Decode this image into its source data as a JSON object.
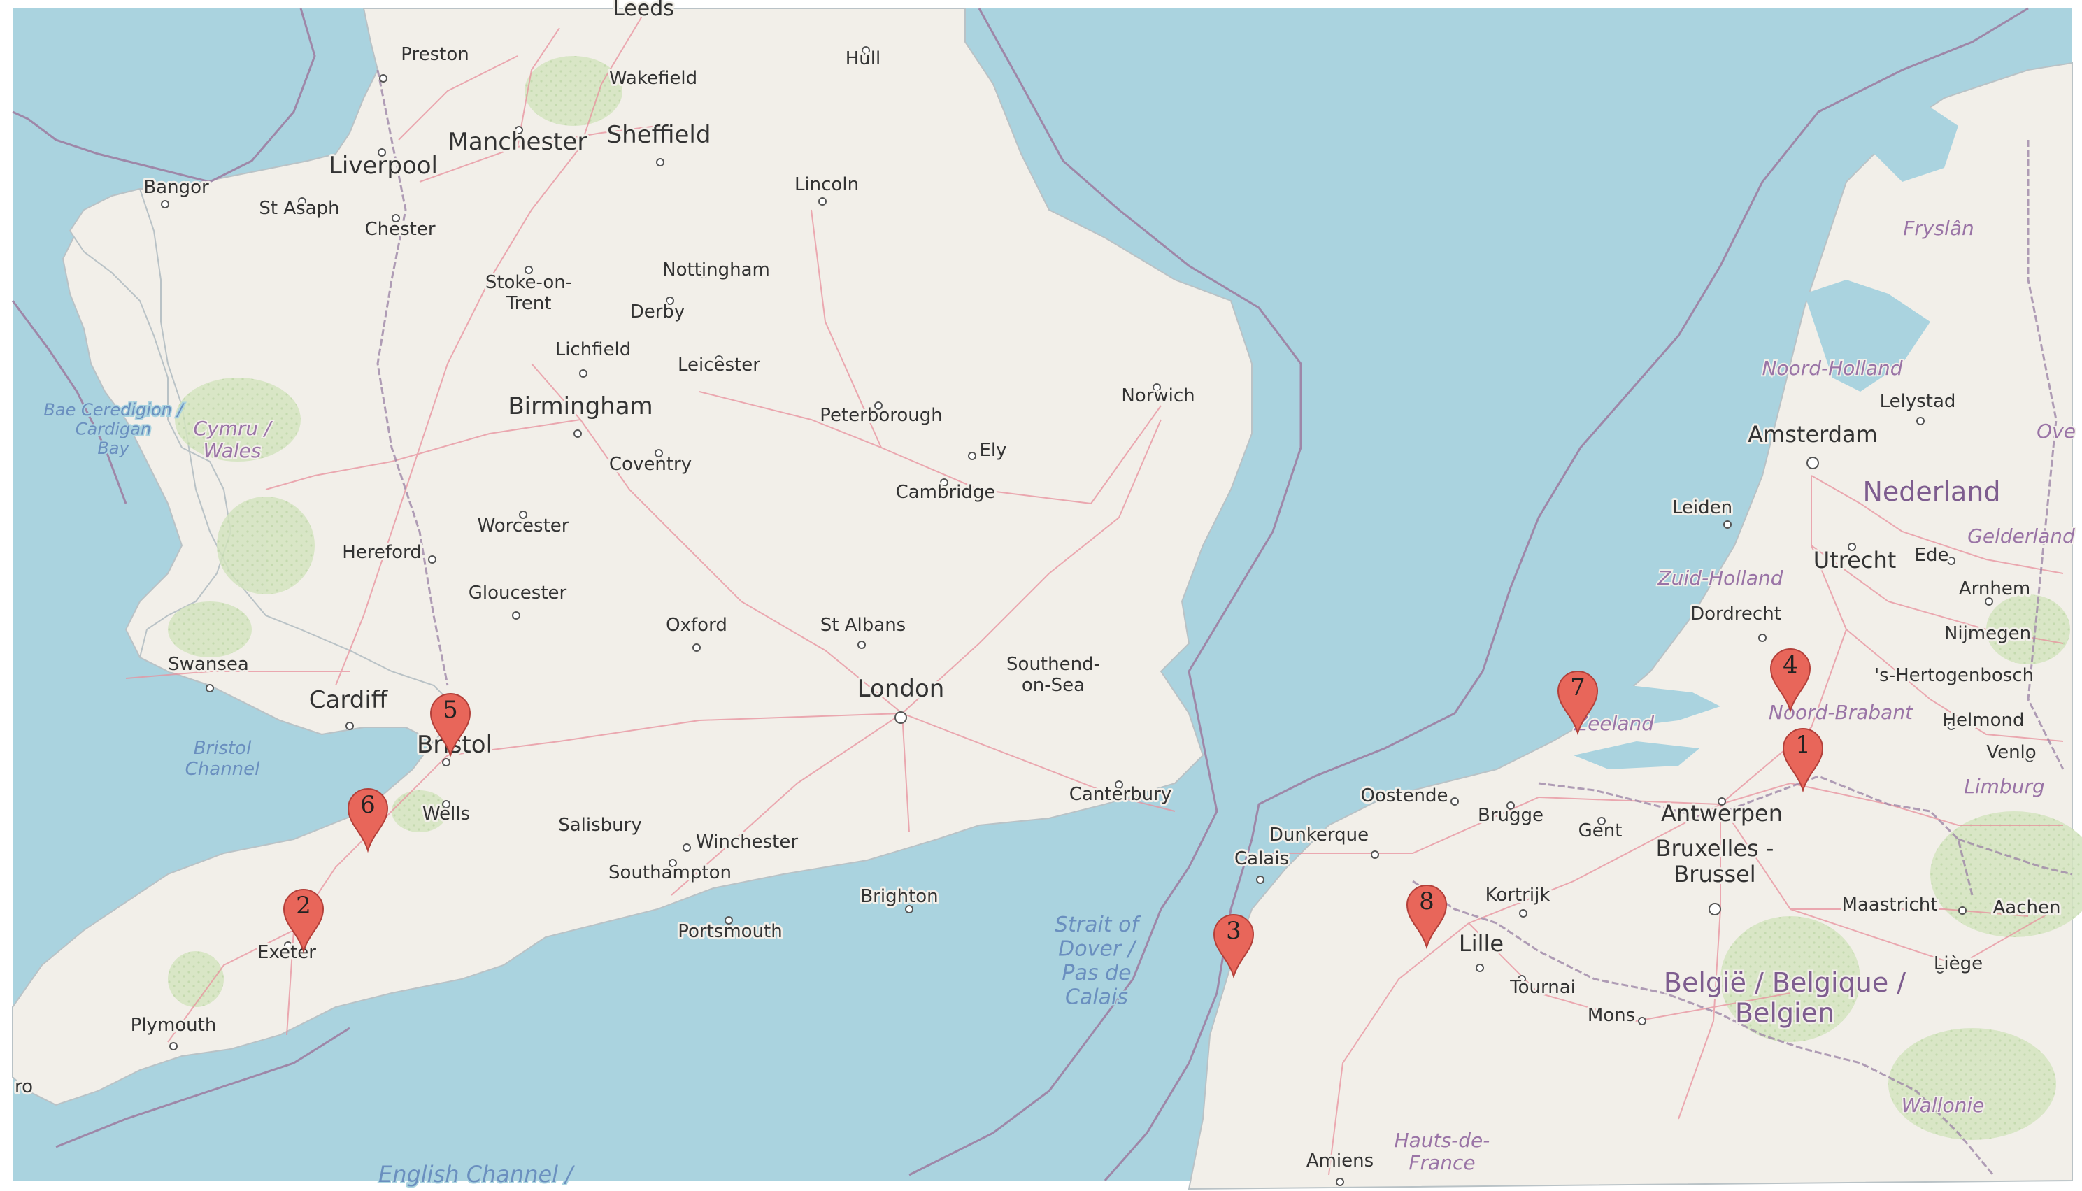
{
  "map": {
    "colors": {
      "water": "#aad3df",
      "land": "#f2efe9",
      "road": "#e8909c",
      "border": "#9e87a8",
      "marker": "#e8665a"
    },
    "cities": [
      {
        "id": "leeds",
        "name": "Leeds"
      },
      {
        "id": "preston",
        "name": "Preston"
      },
      {
        "id": "hull",
        "name": "Hull"
      },
      {
        "id": "wakefield",
        "name": "Wakefield"
      },
      {
        "id": "manchester",
        "name": "Manchester"
      },
      {
        "id": "sheffield",
        "name": "Sheffield"
      },
      {
        "id": "liverpool",
        "name": "Liverpool"
      },
      {
        "id": "bangor",
        "name": "Bangor"
      },
      {
        "id": "st-asaph",
        "name": "St Asaph"
      },
      {
        "id": "lincoln",
        "name": "Lincoln"
      },
      {
        "id": "chester",
        "name": "Chester"
      },
      {
        "id": "nottingham",
        "name": "Nottingham"
      },
      {
        "id": "stoke",
        "name": "Stoke-on-\nTrent"
      },
      {
        "id": "derby",
        "name": "Derby"
      },
      {
        "id": "lichfield",
        "name": "Lichfield"
      },
      {
        "id": "leicester",
        "name": "Leicester"
      },
      {
        "id": "norwich",
        "name": "Norwich"
      },
      {
        "id": "birmingham",
        "name": "Birmingham"
      },
      {
        "id": "peterborough",
        "name": "Peterborough"
      },
      {
        "id": "ely",
        "name": "Ely"
      },
      {
        "id": "coventry",
        "name": "Coventry"
      },
      {
        "id": "cambridge",
        "name": "Cambridge"
      },
      {
        "id": "worcester",
        "name": "Worcester"
      },
      {
        "id": "hereford",
        "name": "Hereford"
      },
      {
        "id": "gloucester",
        "name": "Gloucester"
      },
      {
        "id": "oxford",
        "name": "Oxford"
      },
      {
        "id": "st-albans",
        "name": "St Albans"
      },
      {
        "id": "swansea",
        "name": "Swansea"
      },
      {
        "id": "southend",
        "name": "Southend-\non-Sea"
      },
      {
        "id": "london",
        "name": "London"
      },
      {
        "id": "cardiff",
        "name": "Cardiff"
      },
      {
        "id": "bristol",
        "name": "Bristol"
      },
      {
        "id": "canterbury",
        "name": "Canterbury"
      },
      {
        "id": "wells",
        "name": "Wells"
      },
      {
        "id": "salisbury",
        "name": "Salisbury"
      },
      {
        "id": "winchester",
        "name": "Winchester"
      },
      {
        "id": "southampton",
        "name": "Southampton"
      },
      {
        "id": "brighton",
        "name": "Brighton"
      },
      {
        "id": "portsmouth",
        "name": "Portsmouth"
      },
      {
        "id": "exeter",
        "name": "Exeter"
      },
      {
        "id": "plymouth",
        "name": "Plymouth"
      },
      {
        "id": "ro",
        "name": "ro"
      },
      {
        "id": "amsterdam",
        "name": "Amsterdam"
      },
      {
        "id": "lelystad",
        "name": "Lelystad"
      },
      {
        "id": "leiden",
        "name": "Leiden"
      },
      {
        "id": "utrecht",
        "name": "Utrecht"
      },
      {
        "id": "ede",
        "name": "Ede"
      },
      {
        "id": "arnhem",
        "name": "Arnhem"
      },
      {
        "id": "dordrecht",
        "name": "Dordrecht"
      },
      {
        "id": "nijmegen",
        "name": "Nijmegen"
      },
      {
        "id": "hertogenbosch",
        "name": "'s-Hertogenbosch"
      },
      {
        "id": "helmond",
        "name": "Helmond"
      },
      {
        "id": "venlo",
        "name": "Venlo"
      },
      {
        "id": "oostende",
        "name": "Oostende"
      },
      {
        "id": "brugge",
        "name": "Brugge"
      },
      {
        "id": "gent",
        "name": "Gent"
      },
      {
        "id": "antwerpen",
        "name": "Antwerpen"
      },
      {
        "id": "bruxelles",
        "name": "Bruxelles -\nBrussel"
      },
      {
        "id": "dunkerque",
        "name": "Dunkerque"
      },
      {
        "id": "calais",
        "name": "Calais"
      },
      {
        "id": "kortrijk",
        "name": "Kortrijk"
      },
      {
        "id": "lille",
        "name": "Lille"
      },
      {
        "id": "tournai",
        "name": "Tournai"
      },
      {
        "id": "mons",
        "name": "Mons"
      },
      {
        "id": "maastricht",
        "name": "Maastricht"
      },
      {
        "id": "aachen",
        "name": "Aachen"
      },
      {
        "id": "liege",
        "name": "Liège"
      },
      {
        "id": "amiens",
        "name": "Amiens"
      }
    ],
    "water_labels": [
      {
        "id": "cardigan-bay",
        "name": "Bae Ceredigion /\nCardigan\nBay"
      },
      {
        "id": "bristol-channel",
        "name": "Bristol\nChannel"
      },
      {
        "id": "strait-of-dover",
        "name": "Strait of\nDover /\nPas de\nCalais"
      },
      {
        "id": "english-channel",
        "name": "English Channel /"
      }
    ],
    "region_labels": [
      {
        "id": "cymru",
        "name": "Cymru /\nWales"
      },
      {
        "id": "fryslan",
        "name": "Fryslân"
      },
      {
        "id": "noord-holland",
        "name": "Noord-Holland"
      },
      {
        "id": "zuid-holland",
        "name": "Zuid-Holland"
      },
      {
        "id": "gelderland",
        "name": "Gelderland"
      },
      {
        "id": "overijssel",
        "name": "Ove"
      },
      {
        "id": "zeeland",
        "name": "Zeeland"
      },
      {
        "id": "noord-brabant",
        "name": "Noord-Brabant"
      },
      {
        "id": "limburg",
        "name": "Limburg"
      },
      {
        "id": "wallonie",
        "name": "Wallonie"
      },
      {
        "id": "hauts-de-france",
        "name": "Hauts-de-\nFrance"
      }
    ],
    "country_labels": [
      {
        "id": "nederland",
        "name": "Nederland"
      },
      {
        "id": "belgie",
        "name": "België / Belgique /\nBelgien"
      }
    ],
    "markers": [
      {
        "id": "m1",
        "label": "1"
      },
      {
        "id": "m2",
        "label": "2"
      },
      {
        "id": "m3",
        "label": "3"
      },
      {
        "id": "m4",
        "label": "4"
      },
      {
        "id": "m5",
        "label": "5"
      },
      {
        "id": "m6",
        "label": "6"
      },
      {
        "id": "m7",
        "label": "7"
      },
      {
        "id": "m8",
        "label": "8"
      }
    ]
  }
}
